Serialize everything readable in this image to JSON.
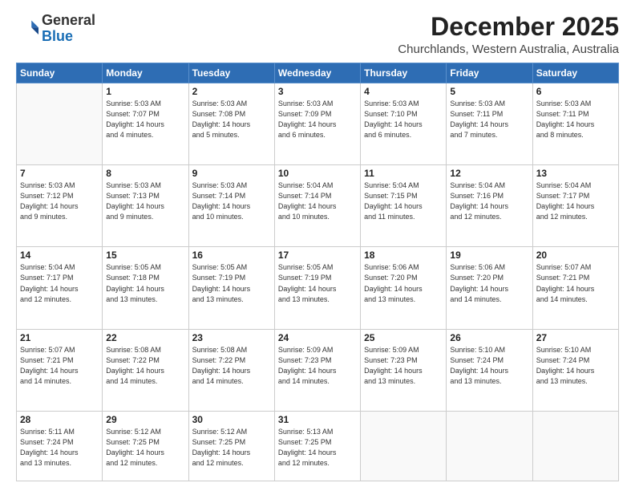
{
  "header": {
    "logo_general": "General",
    "logo_blue": "Blue",
    "month_title": "December 2025",
    "location": "Churchlands, Western Australia, Australia"
  },
  "days_of_week": [
    "Sunday",
    "Monday",
    "Tuesday",
    "Wednesday",
    "Thursday",
    "Friday",
    "Saturday"
  ],
  "weeks": [
    [
      {
        "day": "",
        "info": ""
      },
      {
        "day": "1",
        "info": "Sunrise: 5:03 AM\nSunset: 7:07 PM\nDaylight: 14 hours\nand 4 minutes."
      },
      {
        "day": "2",
        "info": "Sunrise: 5:03 AM\nSunset: 7:08 PM\nDaylight: 14 hours\nand 5 minutes."
      },
      {
        "day": "3",
        "info": "Sunrise: 5:03 AM\nSunset: 7:09 PM\nDaylight: 14 hours\nand 6 minutes."
      },
      {
        "day": "4",
        "info": "Sunrise: 5:03 AM\nSunset: 7:10 PM\nDaylight: 14 hours\nand 6 minutes."
      },
      {
        "day": "5",
        "info": "Sunrise: 5:03 AM\nSunset: 7:11 PM\nDaylight: 14 hours\nand 7 minutes."
      },
      {
        "day": "6",
        "info": "Sunrise: 5:03 AM\nSunset: 7:11 PM\nDaylight: 14 hours\nand 8 minutes."
      }
    ],
    [
      {
        "day": "7",
        "info": "Sunrise: 5:03 AM\nSunset: 7:12 PM\nDaylight: 14 hours\nand 9 minutes."
      },
      {
        "day": "8",
        "info": "Sunrise: 5:03 AM\nSunset: 7:13 PM\nDaylight: 14 hours\nand 9 minutes."
      },
      {
        "day": "9",
        "info": "Sunrise: 5:03 AM\nSunset: 7:14 PM\nDaylight: 14 hours\nand 10 minutes."
      },
      {
        "day": "10",
        "info": "Sunrise: 5:04 AM\nSunset: 7:14 PM\nDaylight: 14 hours\nand 10 minutes."
      },
      {
        "day": "11",
        "info": "Sunrise: 5:04 AM\nSunset: 7:15 PM\nDaylight: 14 hours\nand 11 minutes."
      },
      {
        "day": "12",
        "info": "Sunrise: 5:04 AM\nSunset: 7:16 PM\nDaylight: 14 hours\nand 12 minutes."
      },
      {
        "day": "13",
        "info": "Sunrise: 5:04 AM\nSunset: 7:17 PM\nDaylight: 14 hours\nand 12 minutes."
      }
    ],
    [
      {
        "day": "14",
        "info": "Sunrise: 5:04 AM\nSunset: 7:17 PM\nDaylight: 14 hours\nand 12 minutes."
      },
      {
        "day": "15",
        "info": "Sunrise: 5:05 AM\nSunset: 7:18 PM\nDaylight: 14 hours\nand 13 minutes."
      },
      {
        "day": "16",
        "info": "Sunrise: 5:05 AM\nSunset: 7:19 PM\nDaylight: 14 hours\nand 13 minutes."
      },
      {
        "day": "17",
        "info": "Sunrise: 5:05 AM\nSunset: 7:19 PM\nDaylight: 14 hours\nand 13 minutes."
      },
      {
        "day": "18",
        "info": "Sunrise: 5:06 AM\nSunset: 7:20 PM\nDaylight: 14 hours\nand 13 minutes."
      },
      {
        "day": "19",
        "info": "Sunrise: 5:06 AM\nSunset: 7:20 PM\nDaylight: 14 hours\nand 14 minutes."
      },
      {
        "day": "20",
        "info": "Sunrise: 5:07 AM\nSunset: 7:21 PM\nDaylight: 14 hours\nand 14 minutes."
      }
    ],
    [
      {
        "day": "21",
        "info": "Sunrise: 5:07 AM\nSunset: 7:21 PM\nDaylight: 14 hours\nand 14 minutes."
      },
      {
        "day": "22",
        "info": "Sunrise: 5:08 AM\nSunset: 7:22 PM\nDaylight: 14 hours\nand 14 minutes."
      },
      {
        "day": "23",
        "info": "Sunrise: 5:08 AM\nSunset: 7:22 PM\nDaylight: 14 hours\nand 14 minutes."
      },
      {
        "day": "24",
        "info": "Sunrise: 5:09 AM\nSunset: 7:23 PM\nDaylight: 14 hours\nand 14 minutes."
      },
      {
        "day": "25",
        "info": "Sunrise: 5:09 AM\nSunset: 7:23 PM\nDaylight: 14 hours\nand 13 minutes."
      },
      {
        "day": "26",
        "info": "Sunrise: 5:10 AM\nSunset: 7:24 PM\nDaylight: 14 hours\nand 13 minutes."
      },
      {
        "day": "27",
        "info": "Sunrise: 5:10 AM\nSunset: 7:24 PM\nDaylight: 14 hours\nand 13 minutes."
      }
    ],
    [
      {
        "day": "28",
        "info": "Sunrise: 5:11 AM\nSunset: 7:24 PM\nDaylight: 14 hours\nand 13 minutes."
      },
      {
        "day": "29",
        "info": "Sunrise: 5:12 AM\nSunset: 7:25 PM\nDaylight: 14 hours\nand 12 minutes."
      },
      {
        "day": "30",
        "info": "Sunrise: 5:12 AM\nSunset: 7:25 PM\nDaylight: 14 hours\nand 12 minutes."
      },
      {
        "day": "31",
        "info": "Sunrise: 5:13 AM\nSunset: 7:25 PM\nDaylight: 14 hours\nand 12 minutes."
      },
      {
        "day": "",
        "info": ""
      },
      {
        "day": "",
        "info": ""
      },
      {
        "day": "",
        "info": ""
      }
    ]
  ]
}
